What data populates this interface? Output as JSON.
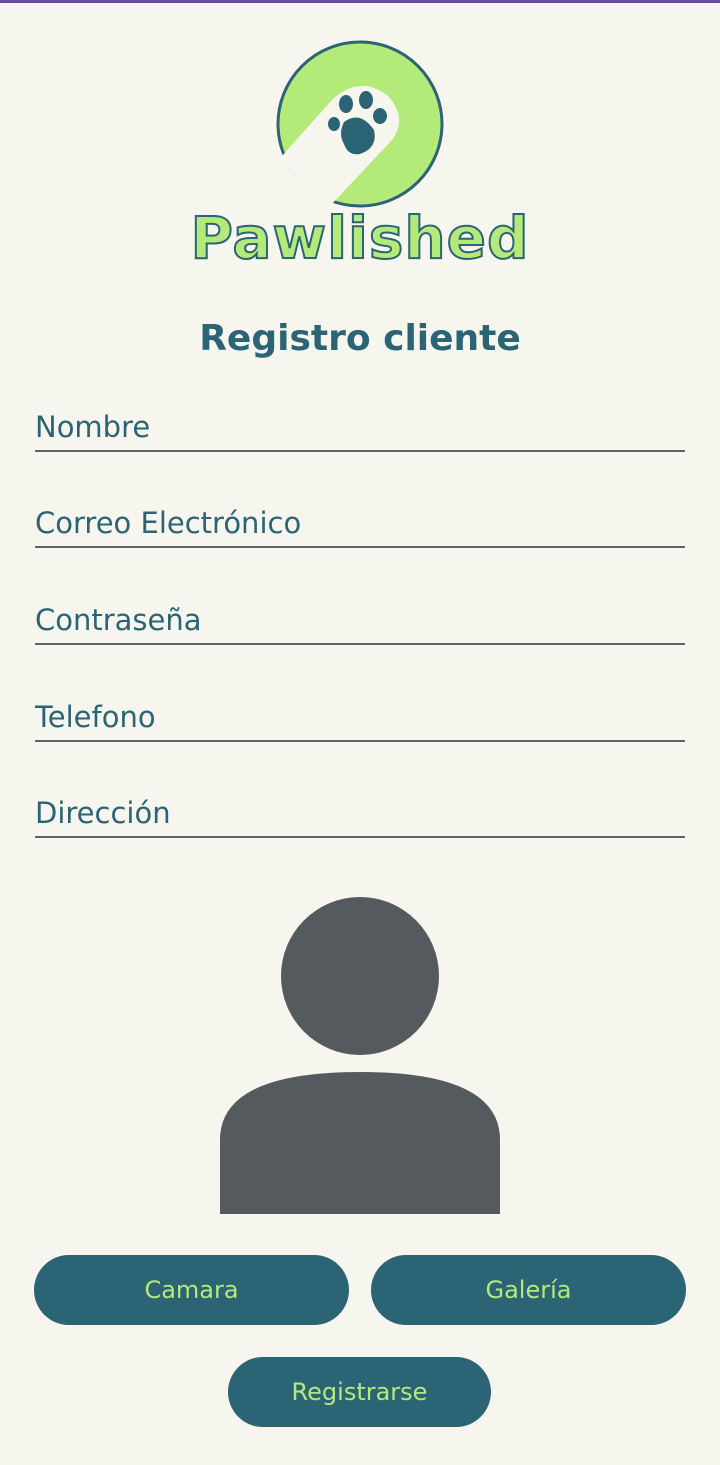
{
  "app": {
    "brand_name": "Pawlished",
    "colors": {
      "primary": "#2a6475",
      "accent": "#b4ea7a",
      "background": "#f7f6ee",
      "avatar": "#545a5e"
    }
  },
  "header": {
    "title": "Registro cliente"
  },
  "form": {
    "fields": [
      {
        "name": "nombre",
        "placeholder": "Nombre",
        "value": ""
      },
      {
        "name": "correo",
        "placeholder": "Correo Electrónico",
        "value": ""
      },
      {
        "name": "contrasena",
        "placeholder": "Contraseña",
        "value": ""
      },
      {
        "name": "telefono",
        "placeholder": "Telefono",
        "value": ""
      },
      {
        "name": "direccion",
        "placeholder": "Dirección",
        "value": ""
      }
    ]
  },
  "photo": {
    "icon": "person-placeholder-icon"
  },
  "actions": {
    "camera_label": "Camara",
    "gallery_label": "Galería",
    "register_label": "Registrarse"
  }
}
